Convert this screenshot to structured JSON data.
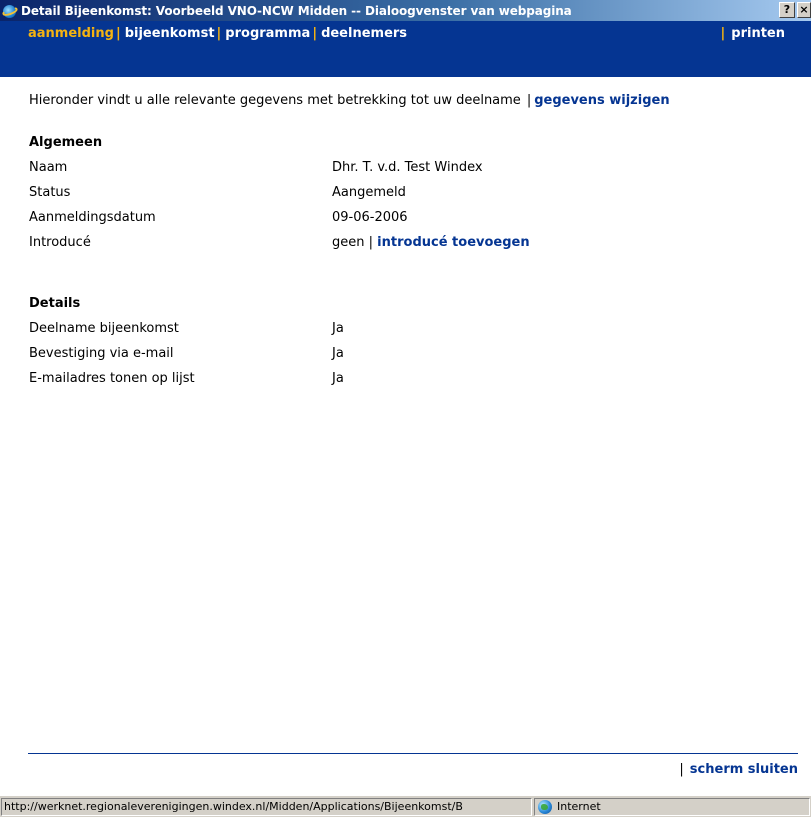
{
  "window": {
    "title": "Detail Bijeenkomst: Voorbeeld VNO-NCW Midden -- Dialoogvenster van webpagina",
    "help_label": "?",
    "close_label": "×"
  },
  "nav": {
    "tabs": [
      {
        "label": "aanmelding",
        "active": true
      },
      {
        "label": "bijeenkomst",
        "active": false
      },
      {
        "label": "programma",
        "active": false
      },
      {
        "label": "deelnemers",
        "active": false
      }
    ],
    "separator": "|",
    "print_label": "printen"
  },
  "intro": {
    "text": "Hieronder vindt u alle relevante gegevens met betrekking tot uw deelname",
    "separator": "|",
    "edit_link": "gegevens wijzigen"
  },
  "algemeen": {
    "title": "Algemeen",
    "rows": [
      {
        "label": "Naam",
        "value": "Dhr. T. v.d. Test Windex"
      },
      {
        "label": "Status",
        "value": "Aangemeld"
      },
      {
        "label": "Aanmeldingsdatum",
        "value": "09-06-2006"
      },
      {
        "label": "Introducé",
        "value": "geen",
        "separator": "|",
        "link": "introducé toevoegen"
      }
    ]
  },
  "details": {
    "title": "Details",
    "rows": [
      {
        "label": "Deelname bijeenkomst",
        "value": "Ja"
      },
      {
        "label": "Bevestiging via e-mail",
        "value": "Ja"
      },
      {
        "label": "E-mailadres tonen op lijst",
        "value": "Ja"
      }
    ]
  },
  "footer": {
    "separator": "|",
    "close_link": "scherm sluiten"
  },
  "statusbar": {
    "url": "http://werknet.regionaleverenigingen.windex.nl/Midden/Applications/Bijeenkomst/B",
    "zone": "Internet"
  },
  "colors": {
    "nav_background": "#053592",
    "nav_active": "#f5b311",
    "link": "#053592"
  },
  "icons": {
    "title": "ie-page-icon",
    "zone": "internet-globe-icon"
  }
}
